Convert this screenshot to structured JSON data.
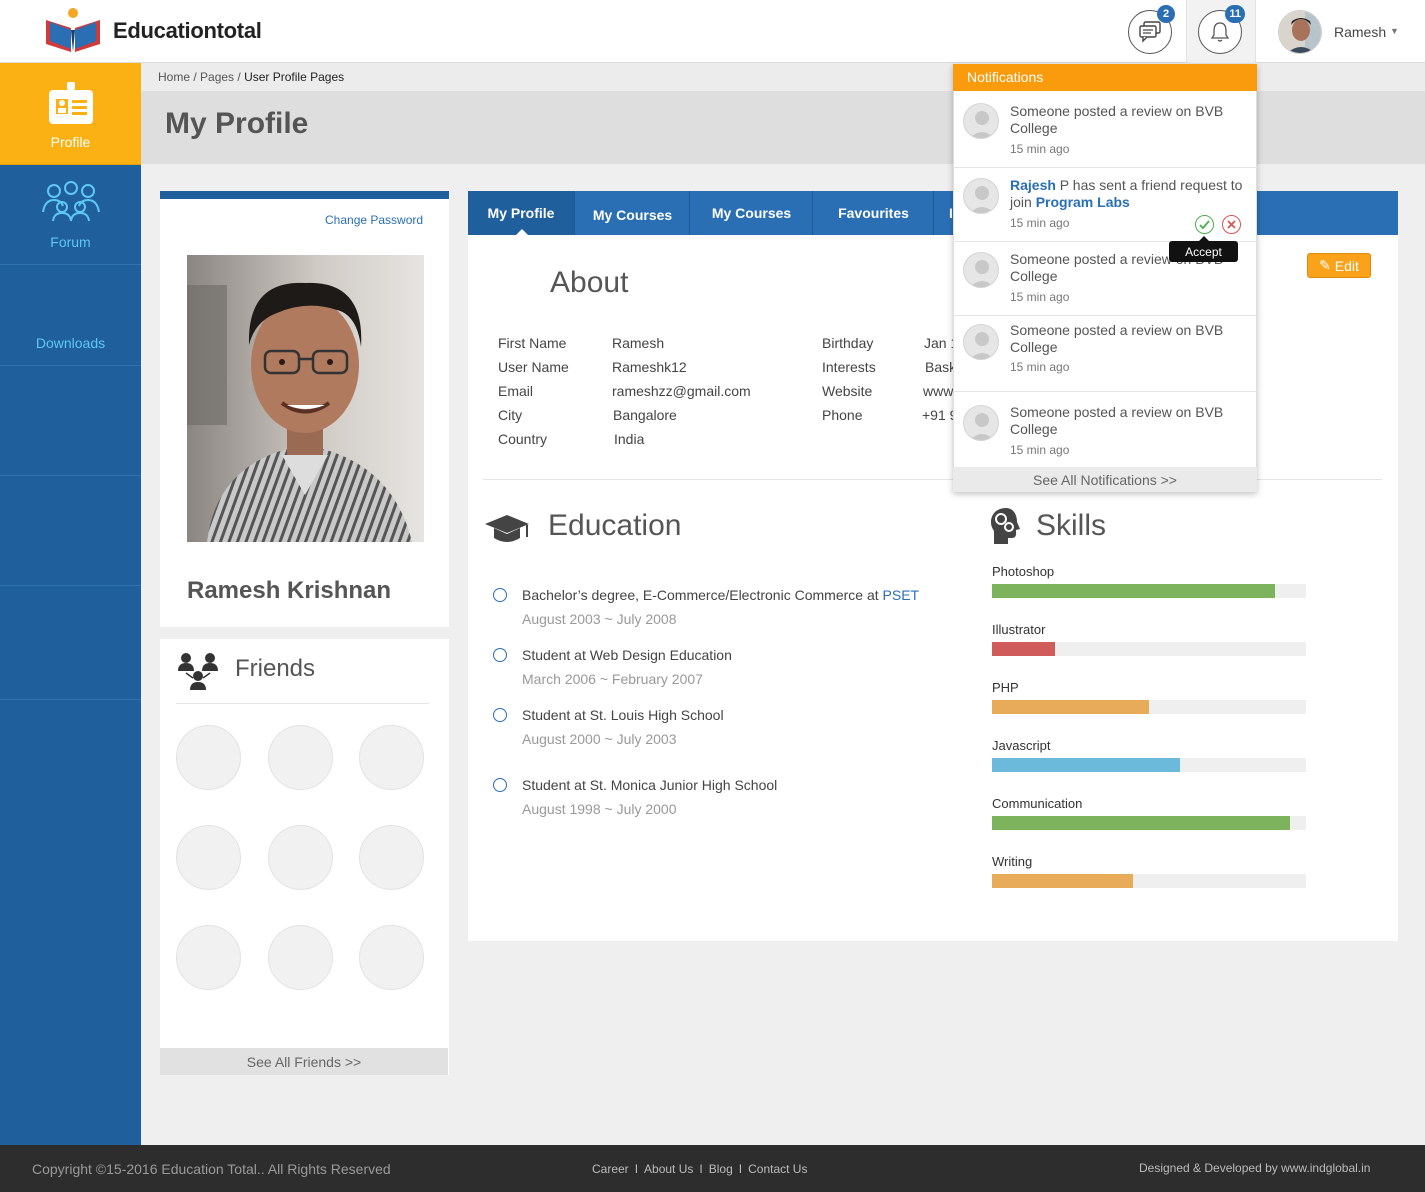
{
  "header": {
    "brand": "Educationtotal",
    "messages_badge": "2",
    "notifications_badge": "11",
    "user_name": "Ramesh"
  },
  "sidebar": {
    "items": [
      {
        "label": "Profile",
        "icon": "profile-card-icon"
      },
      {
        "label": "Forum",
        "icon": "group-icon"
      },
      {
        "label": "Downloads",
        "icon": ""
      }
    ]
  },
  "breadcrumb": {
    "home": "Home",
    "pages": "Pages",
    "current": "User Profile Pages"
  },
  "page_title": "My Profile",
  "profile_card": {
    "change_password": "Change Password",
    "full_name": "Ramesh Krishnan"
  },
  "friends": {
    "title": "Friends",
    "see_all": "See All Friends >>"
  },
  "tabs": [
    "My Profile",
    "My Courses",
    "My Courses",
    "Favourites",
    "I"
  ],
  "about": {
    "title": "About",
    "edit_label": "Edit",
    "left_fields": [
      {
        "label": "First Name",
        "value": "Ramesh"
      },
      {
        "label": "User Name",
        "value": "Rameshk12"
      },
      {
        "label": "Email",
        "value": "rameshzz@gmail.com"
      },
      {
        "label": "City",
        "value": "Bangalore"
      },
      {
        "label": "Country",
        "value": "India"
      }
    ],
    "right_fields": [
      {
        "label": "Birthday",
        "value": "Jan 1"
      },
      {
        "label": "Interests",
        "value": "Bask"
      },
      {
        "label": "Website",
        "value": "www."
      },
      {
        "label": "Phone",
        "value": "+91 9"
      }
    ]
  },
  "education": {
    "title": "Education",
    "items": [
      {
        "title": "Bachelor’s degree, E-Commerce/Electronic Commerce at ",
        "link": "PSET",
        "dates": "August 2003 ~ July 2008"
      },
      {
        "title": "Student at Web Design Education",
        "link": "",
        "dates": "March 2006 ~ February 2007"
      },
      {
        "title": "Student at St. Louis High School",
        "link": "",
        "dates": "August 2000 ~ July 2003"
      },
      {
        "title": "Student at St. Monica Junior High School",
        "link": "",
        "dates": "August 1998 ~ July 2000"
      }
    ]
  },
  "skills": {
    "title": "Skills",
    "items": [
      {
        "name": "Photoshop",
        "level": 0.9,
        "color": "#7cb35c"
      },
      {
        "name": "Illustrator",
        "level": 0.2,
        "color": "#cf5b5b"
      },
      {
        "name": "PHP",
        "level": 0.5,
        "color": "#e8ab5a"
      },
      {
        "name": "Javascript",
        "level": 0.6,
        "color": "#6cbadb"
      },
      {
        "name": "Communication",
        "level": 0.95,
        "color": "#7cb35c"
      },
      {
        "name": "Writing",
        "level": 0.45,
        "color": "#e8ab5a"
      }
    ]
  },
  "notifications": {
    "title": "Notifications",
    "items": [
      {
        "text": "Someone posted a review on BVB College",
        "time": "15 min ago"
      },
      {
        "user": "Rajesh",
        "text_a": " P has sent a friend request to join ",
        "link": "Program Labs",
        "time": "15 min ago"
      },
      {
        "text": "Someone posted a review on BVB College",
        "time": "15 min ago"
      },
      {
        "text": "Someone posted a review on BVB College",
        "time": "15 min ago"
      },
      {
        "text": "Someone posted a review on BVB College",
        "time": "15 min ago"
      }
    ],
    "accept_tooltip": "Accept",
    "see_all": "See  All Notifications >>"
  },
  "footer": {
    "copyright": "Copyright ©15-2016 Education Total.. All Rights Reserved",
    "links": [
      "Career",
      "About Us",
      "Blog",
      "Contact Us"
    ],
    "link_separator": "I",
    "designed_by": "Designed & Developed by www.indglobal.in"
  },
  "colors": {
    "primary": "#1e5f9c",
    "tab_blue": "#2a6fb4",
    "accent_orange": "#f99b0c",
    "profile_active": "#fbb114"
  }
}
